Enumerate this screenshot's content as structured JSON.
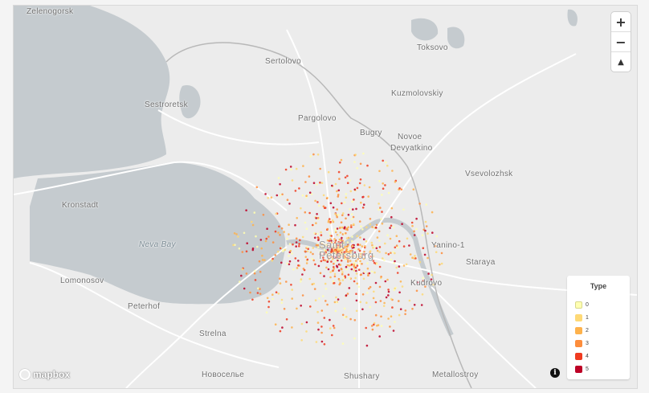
{
  "map": {
    "places": [
      {
        "id": "zelenogorsk",
        "label": "Zelenogorsk"
      },
      {
        "id": "sertolovo",
        "label": "Sertolovo"
      },
      {
        "id": "toksovo",
        "label": "Toksovo"
      },
      {
        "id": "sestroretsk",
        "label": "Sestroretsk"
      },
      {
        "id": "kuzmolovskiy",
        "label": "Kuzmolovskiy"
      },
      {
        "id": "pargolovo",
        "label": "Pargolovo"
      },
      {
        "id": "bugry",
        "label": "Bugry"
      },
      {
        "id": "novoe",
        "label": "Novoe"
      },
      {
        "id": "devyatkino",
        "label": "Devyatkino"
      },
      {
        "id": "vsevolozhsk",
        "label": "Vsevolozhsk"
      },
      {
        "id": "kronstadt",
        "label": "Kronstadt"
      },
      {
        "id": "neva-bay",
        "label": "Neva Bay"
      },
      {
        "id": "saint-petersburg",
        "label": "Saint\nPetersburg"
      },
      {
        "id": "yanino",
        "label": "Yanino-1"
      },
      {
        "id": "staraya",
        "label": "Staraya"
      },
      {
        "id": "lomonosov",
        "label": "Lomonosov"
      },
      {
        "id": "kudrovo",
        "label": "Kudrovo"
      },
      {
        "id": "peterhof",
        "label": "Peterhof"
      },
      {
        "id": "strelna",
        "label": "Strelna"
      },
      {
        "id": "novoselye",
        "label": "Новоселье"
      },
      {
        "id": "shushary",
        "label": "Shushary"
      },
      {
        "id": "metallostroy",
        "label": "Metallostroy"
      }
    ],
    "zoom_in_label": "+",
    "zoom_out_label": "−",
    "compass_label": "▲",
    "attribution_logo": "mapbox",
    "info_label": "i"
  },
  "legend": {
    "title": "Type",
    "items": [
      {
        "label": "0",
        "color": "#ffffb2"
      },
      {
        "label": "1",
        "color": "#fed976"
      },
      {
        "label": "2",
        "color": "#feb24c"
      },
      {
        "label": "3",
        "color": "#fd8d3c"
      },
      {
        "label": "4",
        "color": "#f03b20"
      },
      {
        "label": "5",
        "color": "#bd0026"
      }
    ]
  },
  "colors": {
    "water": "#c5cbcf",
    "land": "#ececec",
    "road": "#ffffff"
  }
}
